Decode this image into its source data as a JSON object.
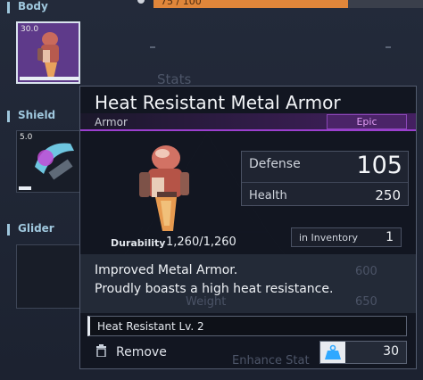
{
  "header": {
    "progress_text": "75 / 100",
    "progress_fraction": 0.75
  },
  "sidebar": {
    "categories": [
      {
        "label": "Body"
      },
      {
        "label": "Shield"
      },
      {
        "label": "Glider"
      }
    ],
    "slots": [
      {
        "value": "30.0"
      },
      {
        "value": "5.0"
      }
    ]
  },
  "background_text": {
    "stats_heading": "Stats",
    "ghost_value_1": "600",
    "ghost_value_2": "650",
    "ghost_weight": "Weight",
    "ghost_enhance": "Enhance Stat"
  },
  "tooltip": {
    "title": "Heat Resistant Metal Armor",
    "type": "Armor",
    "rarity": "Epic",
    "durability_label": "Durability",
    "durability_value": "1,260/1,260",
    "stats": {
      "defense_label": "Defense",
      "defense_value": "105",
      "health_label": "Health",
      "health_value": "250"
    },
    "inventory": {
      "label": "in Inventory",
      "value": "1"
    },
    "description_lines": [
      "Improved Metal Armor.",
      "Proudly boasts a high heat resistance."
    ],
    "skill": "Heat Resistant Lv. 2",
    "remove_label": "Remove",
    "weight_value": "30"
  },
  "colors": {
    "rarity_accent": "#9b3fcf",
    "rarity_text": "#e39df5",
    "progress_fill": "#e0863a",
    "category_accent": "#9fc7dd",
    "weight_icon": "#2fa8ff"
  },
  "icons": {
    "remove": "trash-icon",
    "weight": "weight-icon",
    "armor": "armor-item-art",
    "shield": "shield-item-art"
  }
}
